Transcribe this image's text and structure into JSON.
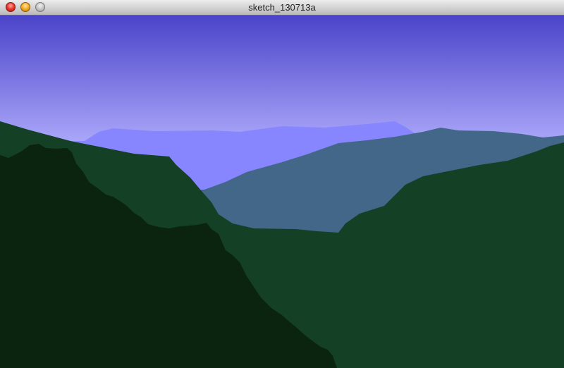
{
  "window": {
    "title": "sketch_130713a"
  },
  "controls": {
    "close_icon": "close-icon",
    "minimize_icon": "minimize-icon",
    "zoom_icon": "zoom-icon"
  },
  "scene": {
    "sky_top_color": "#4b44c9",
    "sky_bottom_color": "#b5b2ff",
    "far_ridge_color": "#8886fe",
    "mid_ridge_color": "#426788",
    "near_ridge_color": "#144026",
    "foreground_ridge_color": "#0b2410"
  }
}
